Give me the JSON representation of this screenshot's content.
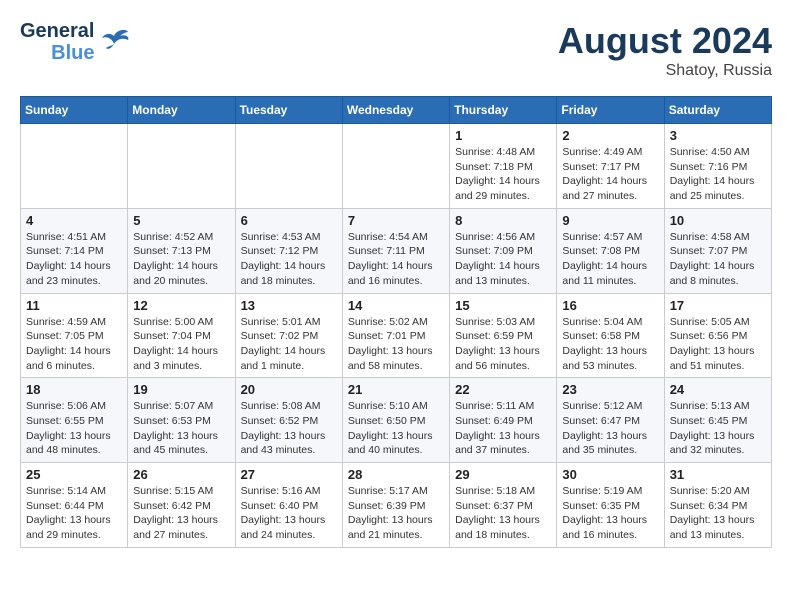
{
  "logo": {
    "line1": "General",
    "line2": "Blue"
  },
  "title": {
    "month_year": "August 2024",
    "location": "Shatoy, Russia"
  },
  "weekdays": [
    "Sunday",
    "Monday",
    "Tuesday",
    "Wednesday",
    "Thursday",
    "Friday",
    "Saturday"
  ],
  "weeks": [
    [
      {
        "day": "",
        "info": ""
      },
      {
        "day": "",
        "info": ""
      },
      {
        "day": "",
        "info": ""
      },
      {
        "day": "",
        "info": ""
      },
      {
        "day": "1",
        "info": "Sunrise: 4:48 AM\nSunset: 7:18 PM\nDaylight: 14 hours\nand 29 minutes."
      },
      {
        "day": "2",
        "info": "Sunrise: 4:49 AM\nSunset: 7:17 PM\nDaylight: 14 hours\nand 27 minutes."
      },
      {
        "day": "3",
        "info": "Sunrise: 4:50 AM\nSunset: 7:16 PM\nDaylight: 14 hours\nand 25 minutes."
      }
    ],
    [
      {
        "day": "4",
        "info": "Sunrise: 4:51 AM\nSunset: 7:14 PM\nDaylight: 14 hours\nand 23 minutes."
      },
      {
        "day": "5",
        "info": "Sunrise: 4:52 AM\nSunset: 7:13 PM\nDaylight: 14 hours\nand 20 minutes."
      },
      {
        "day": "6",
        "info": "Sunrise: 4:53 AM\nSunset: 7:12 PM\nDaylight: 14 hours\nand 18 minutes."
      },
      {
        "day": "7",
        "info": "Sunrise: 4:54 AM\nSunset: 7:11 PM\nDaylight: 14 hours\nand 16 minutes."
      },
      {
        "day": "8",
        "info": "Sunrise: 4:56 AM\nSunset: 7:09 PM\nDaylight: 14 hours\nand 13 minutes."
      },
      {
        "day": "9",
        "info": "Sunrise: 4:57 AM\nSunset: 7:08 PM\nDaylight: 14 hours\nand 11 minutes."
      },
      {
        "day": "10",
        "info": "Sunrise: 4:58 AM\nSunset: 7:07 PM\nDaylight: 14 hours\nand 8 minutes."
      }
    ],
    [
      {
        "day": "11",
        "info": "Sunrise: 4:59 AM\nSunset: 7:05 PM\nDaylight: 14 hours\nand 6 minutes."
      },
      {
        "day": "12",
        "info": "Sunrise: 5:00 AM\nSunset: 7:04 PM\nDaylight: 14 hours\nand 3 minutes."
      },
      {
        "day": "13",
        "info": "Sunrise: 5:01 AM\nSunset: 7:02 PM\nDaylight: 14 hours\nand 1 minute."
      },
      {
        "day": "14",
        "info": "Sunrise: 5:02 AM\nSunset: 7:01 PM\nDaylight: 13 hours\nand 58 minutes."
      },
      {
        "day": "15",
        "info": "Sunrise: 5:03 AM\nSunset: 6:59 PM\nDaylight: 13 hours\nand 56 minutes."
      },
      {
        "day": "16",
        "info": "Sunrise: 5:04 AM\nSunset: 6:58 PM\nDaylight: 13 hours\nand 53 minutes."
      },
      {
        "day": "17",
        "info": "Sunrise: 5:05 AM\nSunset: 6:56 PM\nDaylight: 13 hours\nand 51 minutes."
      }
    ],
    [
      {
        "day": "18",
        "info": "Sunrise: 5:06 AM\nSunset: 6:55 PM\nDaylight: 13 hours\nand 48 minutes."
      },
      {
        "day": "19",
        "info": "Sunrise: 5:07 AM\nSunset: 6:53 PM\nDaylight: 13 hours\nand 45 minutes."
      },
      {
        "day": "20",
        "info": "Sunrise: 5:08 AM\nSunset: 6:52 PM\nDaylight: 13 hours\nand 43 minutes."
      },
      {
        "day": "21",
        "info": "Sunrise: 5:10 AM\nSunset: 6:50 PM\nDaylight: 13 hours\nand 40 minutes."
      },
      {
        "day": "22",
        "info": "Sunrise: 5:11 AM\nSunset: 6:49 PM\nDaylight: 13 hours\nand 37 minutes."
      },
      {
        "day": "23",
        "info": "Sunrise: 5:12 AM\nSunset: 6:47 PM\nDaylight: 13 hours\nand 35 minutes."
      },
      {
        "day": "24",
        "info": "Sunrise: 5:13 AM\nSunset: 6:45 PM\nDaylight: 13 hours\nand 32 minutes."
      }
    ],
    [
      {
        "day": "25",
        "info": "Sunrise: 5:14 AM\nSunset: 6:44 PM\nDaylight: 13 hours\nand 29 minutes."
      },
      {
        "day": "26",
        "info": "Sunrise: 5:15 AM\nSunset: 6:42 PM\nDaylight: 13 hours\nand 27 minutes."
      },
      {
        "day": "27",
        "info": "Sunrise: 5:16 AM\nSunset: 6:40 PM\nDaylight: 13 hours\nand 24 minutes."
      },
      {
        "day": "28",
        "info": "Sunrise: 5:17 AM\nSunset: 6:39 PM\nDaylight: 13 hours\nand 21 minutes."
      },
      {
        "day": "29",
        "info": "Sunrise: 5:18 AM\nSunset: 6:37 PM\nDaylight: 13 hours\nand 18 minutes."
      },
      {
        "day": "30",
        "info": "Sunrise: 5:19 AM\nSunset: 6:35 PM\nDaylight: 13 hours\nand 16 minutes."
      },
      {
        "day": "31",
        "info": "Sunrise: 5:20 AM\nSunset: 6:34 PM\nDaylight: 13 hours\nand 13 minutes."
      }
    ]
  ]
}
